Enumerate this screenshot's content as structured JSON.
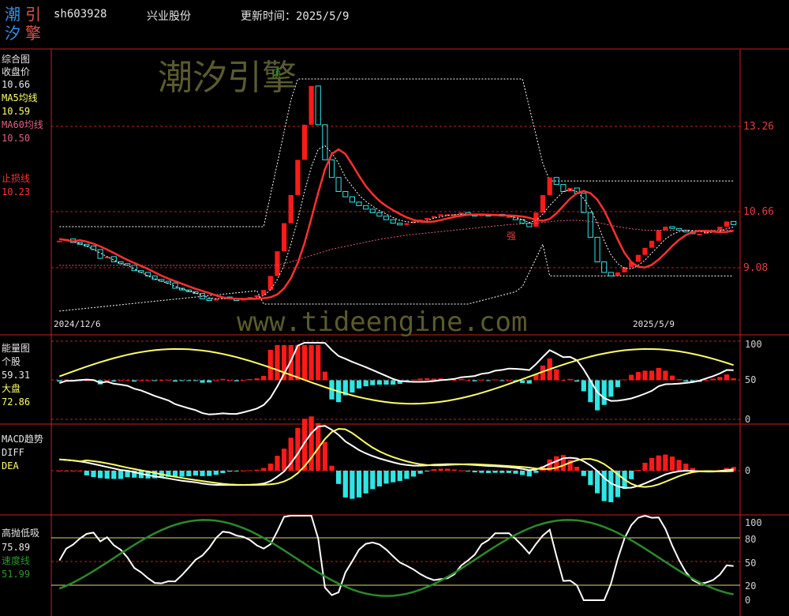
{
  "header": {
    "logo_chars": [
      "潮",
      "引",
      "汐",
      "擎"
    ],
    "code": "sh603928",
    "name": "兴业股份",
    "update_label": "更新时间：2025/5/9"
  },
  "watermarks": {
    "brand": "潮汐引擎",
    "site": "www.tideengine.com"
  },
  "colors": {
    "background": "#000000",
    "grid_red": "#c81e1e",
    "up_red": "#ff1a1a",
    "down_cyan": "#2ee6e6",
    "ma5_yellow": "#ffff66",
    "ma60_pink": "#e06080",
    "stop_red": "#ff3030",
    "white": "#ffffff",
    "green": "#2a8a2a"
  },
  "panel_main": {
    "title": "综合图",
    "close_label": "收盘价",
    "close_value": "10.66",
    "ma5_label": "MA5均线",
    "ma5_value": "10.59",
    "ma60_label": "MA60均线",
    "ma60_value": "10.50",
    "stop_label": "止损线",
    "stop_value": "10.23",
    "price_ticks": [
      "13.26",
      "10.66",
      "9.08"
    ],
    "top_marker": "顶",
    "strong_marker": "强",
    "date_start": "2024/12/6",
    "date_end": "2025/5/9"
  },
  "panel_energy": {
    "title": "能量图",
    "stock_label": "个股",
    "stock_value": "59.31",
    "market_label": "大盘",
    "market_value": "72.86",
    "ticks": [
      "100",
      "50",
      "0"
    ]
  },
  "panel_macd": {
    "title": "MACD趋势",
    "diff_label": "DIFF",
    "dea_label": "DEA",
    "ticks": [
      "0"
    ]
  },
  "panel_osc": {
    "title": "高抛低吸",
    "osc_value": "75.89",
    "speed_label": "速度线",
    "speed_value": "51.99",
    "ticks": [
      "100",
      "80",
      "50",
      "20",
      "0"
    ]
  },
  "chart_data": {
    "type": "candlestick",
    "price_axis_labels": [
      13.26,
      10.66,
      9.08
    ],
    "close": [
      10.2,
      10.25,
      10.15,
      10.1,
      10.05,
      9.95,
      9.7,
      9.75,
      9.6,
      9.55,
      9.5,
      9.35,
      9.3,
      9.2,
      9.1,
      9.05,
      9.0,
      8.85,
      8.8,
      8.75,
      8.7,
      8.55,
      8.5,
      8.55,
      8.6,
      8.55,
      8.5,
      8.55,
      8.6,
      8.65,
      8.8,
      9.2,
      9.9,
      10.7,
      11.5,
      12.5,
      13.5,
      14.6,
      13.5,
      12.5,
      12.0,
      11.6,
      11.45,
      11.3,
      11.2,
      11.1,
      11.0,
      10.9,
      10.8,
      10.7,
      10.65,
      10.7,
      10.75,
      10.8,
      10.85,
      10.9,
      10.95,
      10.95,
      10.95,
      11.0,
      10.95,
      10.9,
      10.95,
      10.9,
      10.95,
      10.9,
      10.9,
      10.8,
      10.7,
      10.6,
      11.0,
      11.5,
      12.0,
      11.8,
      11.6,
      11.7,
      11.55,
      11.0,
      10.3,
      9.6,
      9.3,
      9.2,
      9.3,
      9.45,
      9.6,
      9.8,
      10.0,
      10.2,
      10.5,
      10.6,
      10.55,
      10.5,
      10.45,
      10.4,
      10.4,
      10.45,
      10.5,
      10.6,
      10.75,
      10.66
    ],
    "ma5": [
      10.25,
      10.22,
      10.18,
      10.12,
      10.05,
      9.95,
      9.85,
      9.75,
      9.65,
      9.55,
      9.5,
      9.4,
      9.3,
      9.2,
      9.12,
      9.05,
      8.98,
      8.9,
      8.83,
      8.77,
      8.72,
      8.64,
      8.58,
      8.55,
      8.55,
      8.55,
      8.54,
      8.55,
      8.56,
      8.58,
      8.64,
      8.8,
      9.1,
      9.5,
      10.1,
      10.8,
      11.6,
      12.3,
      12.8,
      12.9,
      12.7,
      12.4,
      12.0,
      11.75,
      11.5,
      11.32,
      11.18,
      11.06,
      10.96,
      10.86,
      10.78,
      10.74,
      10.72,
      10.74,
      10.78,
      10.84,
      10.88,
      10.92,
      10.94,
      10.95,
      10.95,
      10.94,
      10.93,
      10.92,
      10.92,
      10.91,
      10.9,
      10.86,
      10.8,
      10.72,
      10.78,
      10.96,
      11.2,
      11.4,
      11.6,
      11.65,
      11.6,
      11.4,
      11.1,
      10.7,
      10.2,
      9.8,
      9.55,
      9.42,
      9.4,
      9.5,
      9.65,
      9.85,
      10.05,
      10.25,
      10.38,
      10.46,
      10.5,
      10.48,
      10.46,
      10.44,
      10.44,
      10.48,
      10.54,
      10.59
    ],
    "ma60": [
      9.5,
      9.5,
      9.5,
      9.5,
      9.5,
      9.5,
      9.5,
      9.5,
      9.5,
      9.5,
      9.5,
      9.5,
      9.5,
      9.5,
      9.5,
      9.5,
      9.5,
      9.5,
      9.5,
      9.5,
      9.5,
      9.5,
      9.5,
      9.5,
      9.5,
      9.5,
      9.5,
      9.5,
      9.5,
      9.5,
      9.5,
      9.5,
      9.5,
      9.55,
      9.6,
      9.66,
      9.72,
      9.78,
      9.84,
      9.9,
      9.96,
      10.0,
      10.04,
      10.08,
      10.12,
      10.16,
      10.2,
      10.24,
      10.27,
      10.3,
      10.33,
      10.36,
      10.38,
      10.4,
      10.42,
      10.44,
      10.46,
      10.48,
      10.5,
      10.52,
      10.54,
      10.56,
      10.58,
      10.6,
      10.62,
      10.64,
      10.66,
      10.67,
      10.68,
      10.69,
      10.7,
      10.72,
      10.74,
      10.76,
      10.77,
      10.78,
      10.78,
      10.77,
      10.75,
      10.72,
      10.68,
      10.64,
      10.6,
      10.57,
      10.54,
      10.52,
      10.5,
      10.5,
      10.5,
      10.5,
      10.5,
      10.5,
      10.5,
      10.5,
      10.5,
      10.5,
      10.5,
      10.5,
      10.5,
      10.5
    ]
  }
}
